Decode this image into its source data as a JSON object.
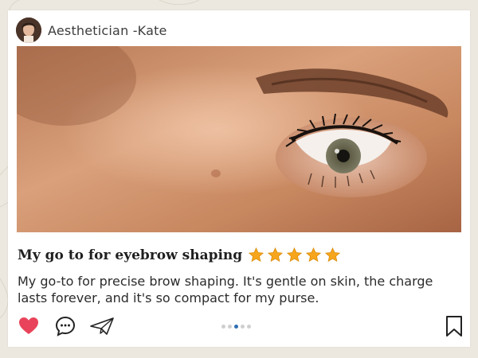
{
  "post": {
    "author": "Aesthetician -Kate",
    "title": "My go to for eyebrow shaping",
    "rating": 5,
    "rating_max": 5,
    "body": "My go-to for precise brow shaping. It's gentle on skin, the charge lasts forever, and it's so compact for my purse."
  },
  "carousel": {
    "count": 5,
    "active_index": 2
  },
  "actions": {
    "like_icon": "heart-icon",
    "comment_icon": "comment-icon",
    "share_icon": "paper-plane-icon",
    "save_icon": "bookmark-icon"
  },
  "colors": {
    "like": "#e8435a",
    "star": "#f6a51c",
    "active_dot": "#2f6fb3",
    "background": "#ece8e0"
  }
}
